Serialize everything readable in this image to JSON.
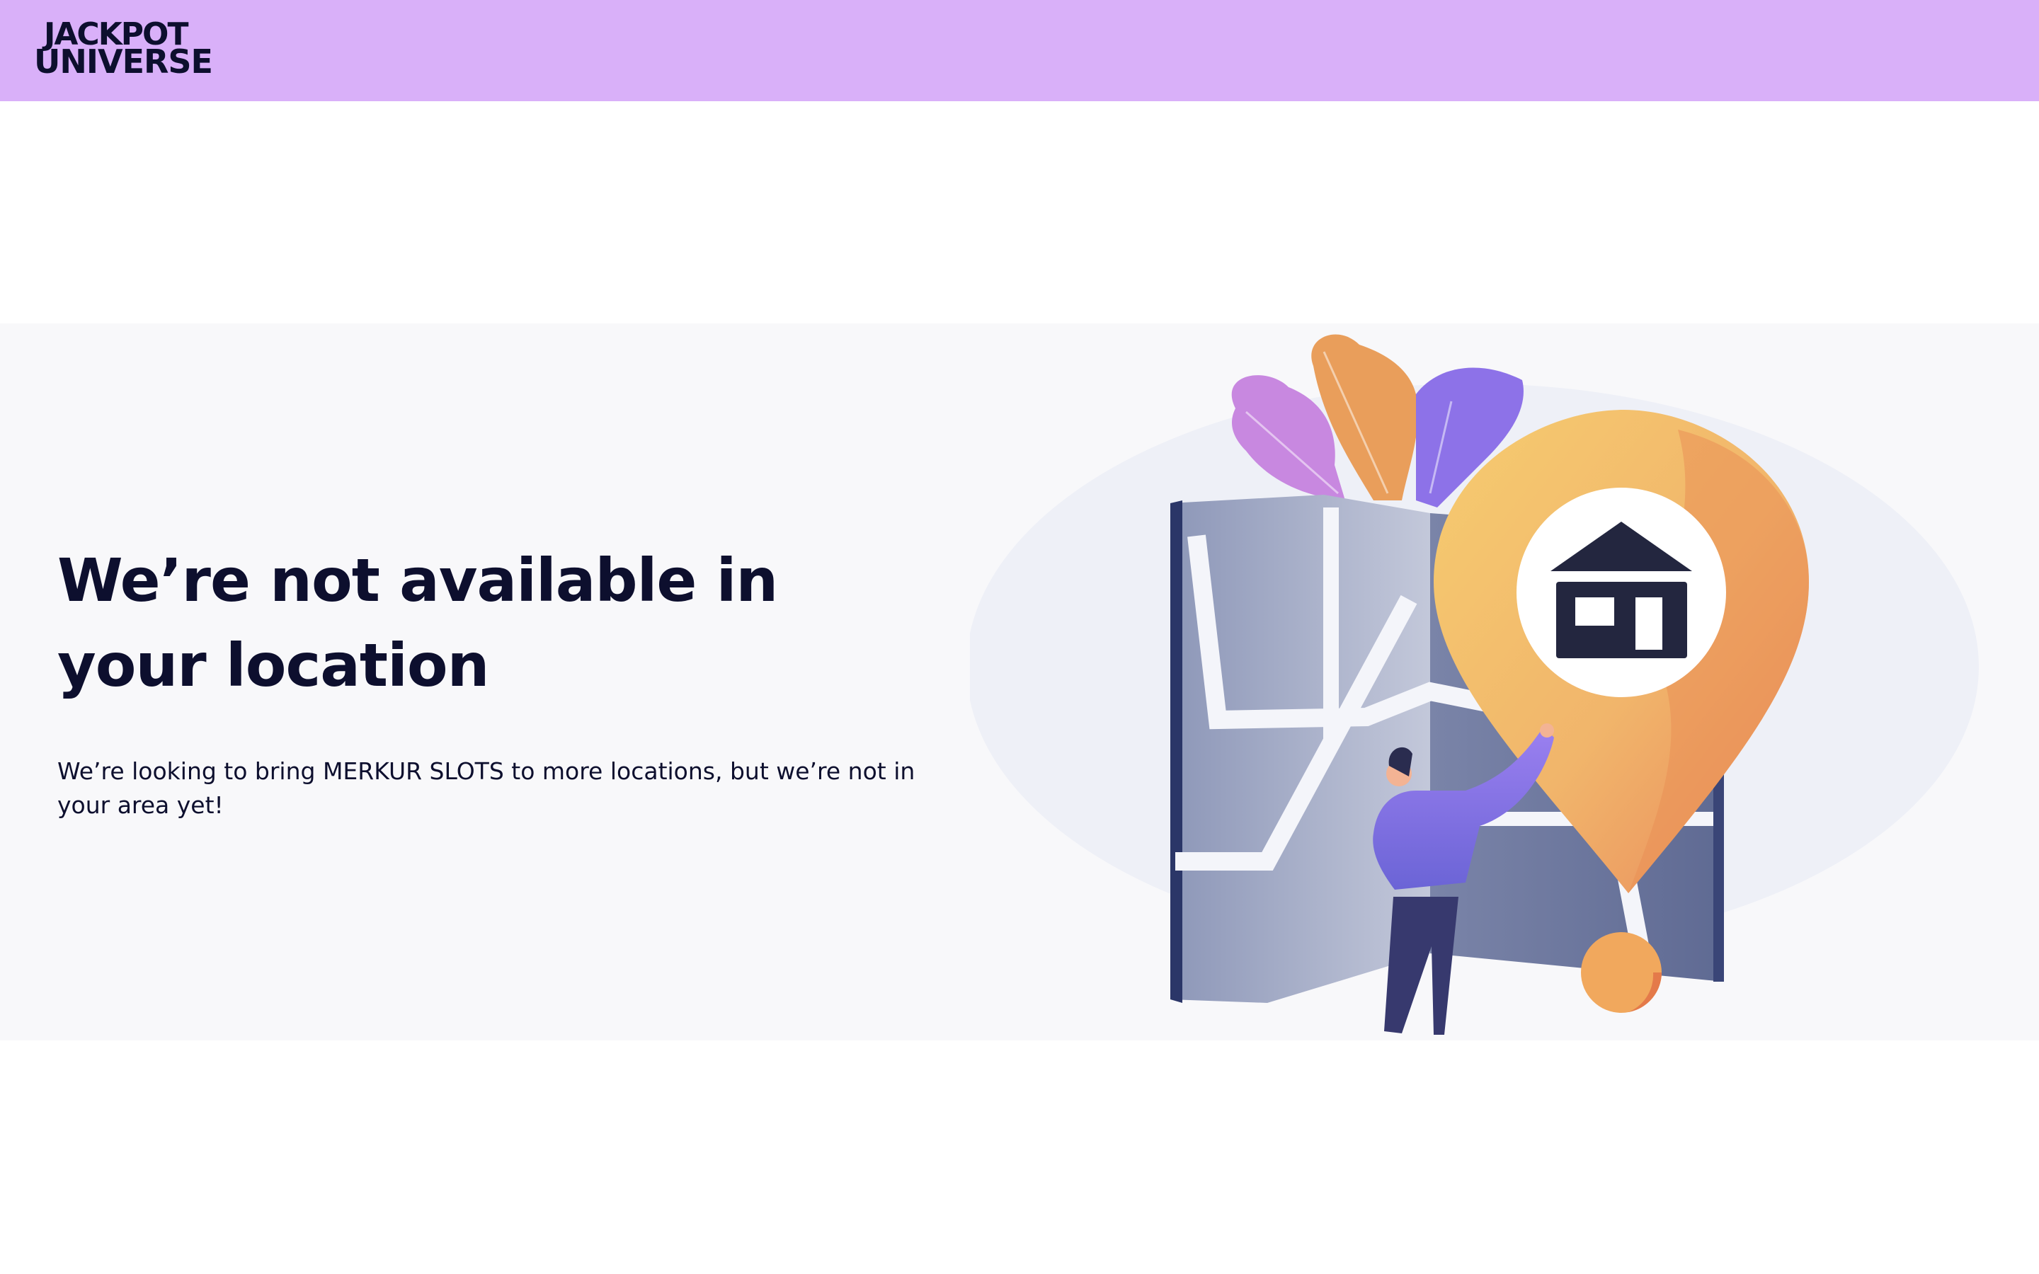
{
  "header": {
    "brand_line1": "JACKPOT",
    "brand_line2": "UNIVERSE",
    "background_color": "#d9b0f9"
  },
  "main": {
    "title": "We’re not available in your location",
    "message": "We’re looking to bring MERKUR SLOTS to more locations, but we’re not in your area yet!",
    "illustration_icon": "location-pin-house-icon"
  }
}
